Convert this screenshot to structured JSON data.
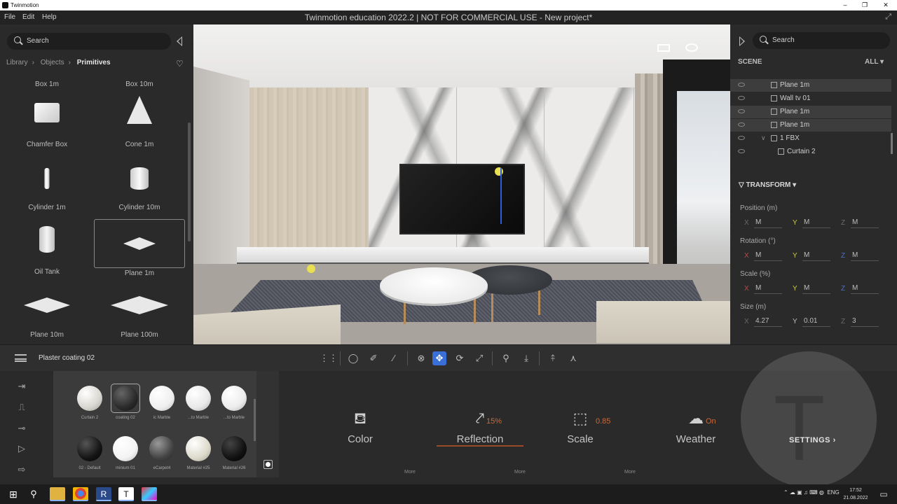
{
  "window": {
    "app_name": "Twinmotion",
    "doc_title": "Twinmotion education 2022.2 | NOT FOR COMMERCIAL USE - New project*",
    "controls": [
      "–",
      "❐",
      "✕"
    ]
  },
  "menu": [
    "File",
    "Edit",
    "Help"
  ],
  "library": {
    "search_placeholder": "Search",
    "breadcrumb": [
      "Library",
      "Objects",
      "Primitives"
    ],
    "items": [
      {
        "label": "Box 1m",
        "shape": "box-label-only"
      },
      {
        "label": "Box 10m",
        "shape": "box-label-only"
      },
      {
        "label": "Chamfer Box",
        "shape": "box"
      },
      {
        "label": "Cone 1m",
        "shape": "cone"
      },
      {
        "label": "Cylinder 1m",
        "shape": "thin-cylinder"
      },
      {
        "label": "Cylinder 10m",
        "shape": "cylinder"
      },
      {
        "label": "Oil Tank",
        "shape": "tank"
      },
      {
        "label": "Plane 1m",
        "shape": "plane",
        "selected": true
      },
      {
        "label": "Plane 10m",
        "shape": "plane-large"
      },
      {
        "label": "Plane 100m",
        "shape": "plane-xlarge"
      }
    ]
  },
  "scene": {
    "search_placeholder": "Search",
    "header": "SCENE",
    "filter": "ALL",
    "rows": [
      {
        "name": "Plane 1m",
        "highlighted": true
      },
      {
        "name": "Wall tv 01",
        "highlighted": false
      },
      {
        "name": "Plane 1m",
        "highlighted": true
      },
      {
        "name": "Plane 1m",
        "highlighted": true
      },
      {
        "name": "1 FBX",
        "highlighted": false,
        "group": true
      },
      {
        "name": "Curtain 2",
        "highlighted": false
      }
    ]
  },
  "transform": {
    "header": "TRANSFORM",
    "position": {
      "label": "Position (m)",
      "x": "M",
      "y": "M",
      "z": "M"
    },
    "rotation": {
      "label": "Rotation (°)",
      "x": "M",
      "y": "M",
      "z": "M"
    },
    "scale": {
      "label": "Scale (%)",
      "x": "M",
      "y": "M",
      "z": "M"
    },
    "size": {
      "label": "Size (m)",
      "x": "4.27",
      "y": "0.01",
      "z": "3"
    },
    "axes": {
      "x": "X",
      "y": "Y",
      "z": "Z"
    }
  },
  "toolbar": {
    "material_name": "Plaster coating 02"
  },
  "materials": [
    {
      "label": "Curtain 2",
      "color": "#d8d6d0"
    },
    {
      "label": "coating 02",
      "color": "#2a2a2a",
      "selected": true
    },
    {
      "label": "ic Marble",
      "color": "#efefef"
    },
    {
      "label": "...to Marble",
      "color": "#e8e8e8"
    },
    {
      "label": "...to Marble",
      "color": "#ececec"
    },
    {
      "label": "02 - Default",
      "color": "#151515"
    },
    {
      "label": "minium 01",
      "color": "#f3f3f3"
    },
    {
      "label": "eCarpet4",
      "color": "#444444"
    },
    {
      "label": "Material #25",
      "color": "#dcdacb"
    },
    {
      "label": "Material #26",
      "color": "#111111"
    }
  ],
  "properties": [
    {
      "label": "Color",
      "value": "",
      "more": "More"
    },
    {
      "label": "Reflection",
      "value": "15%",
      "more": "More"
    },
    {
      "label": "Scale",
      "value": "0.85",
      "more": "More"
    },
    {
      "label": "Weather",
      "value": "On",
      "more": ""
    }
  ],
  "settings_label": "SETTINGS",
  "taskbar": {
    "lang": "ENG",
    "time": "17:52",
    "date": "21.08.2022"
  },
  "colors": {
    "accent_blue": "#3a6fd8",
    "value_orange": "#c96b3a"
  }
}
